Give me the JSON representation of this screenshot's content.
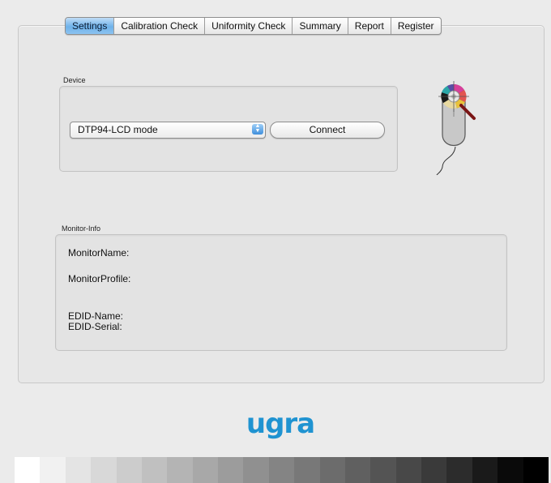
{
  "tabs": [
    {
      "label": "Settings",
      "active": true
    },
    {
      "label": "Calibration Check",
      "active": false
    },
    {
      "label": "Uniformity Check",
      "active": false
    },
    {
      "label": "Summary",
      "active": false
    },
    {
      "label": "Report",
      "active": false
    },
    {
      "label": "Register",
      "active": false
    }
  ],
  "device": {
    "group_label": "Device",
    "instrument_select": "DTP94-LCD mode",
    "connect_label": "Connect"
  },
  "monitor_info": {
    "group_label": "Monitor-Info",
    "monitor_name_label": "MonitorName:",
    "monitor_profile_label": "MonitorProfile:",
    "edid_name_label": "EDID-Name:",
    "edid_serial_label": "EDID-Serial:"
  },
  "brand": {
    "logo_text": "ugra",
    "color": "#1f93d1"
  },
  "icons": {
    "device_icon": "colorimeter-mouse-icon",
    "select_arrows": "updown-arrows-icon"
  },
  "gray_ramp": [
    "#ffffff",
    "#f1f1f1",
    "#e4e4e4",
    "#d8d8d8",
    "#cccccc",
    "#c0c0c0",
    "#b4b4b4",
    "#a8a8a8",
    "#9c9c9c",
    "#909090",
    "#848484",
    "#787878",
    "#6c6c6c",
    "#606060",
    "#545454",
    "#484848",
    "#3a3a3a",
    "#2c2c2c",
    "#1a1a1a",
    "#0a0a0a",
    "#000000"
  ]
}
